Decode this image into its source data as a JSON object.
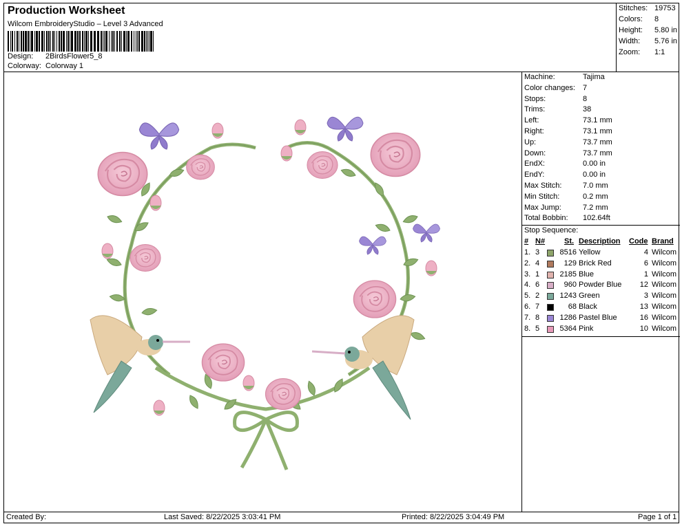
{
  "header": {
    "title": "Production Worksheet",
    "subtitle": "Wilcom EmbroideryStudio – Level 3 Advanced",
    "design_label": "Design:",
    "design_value": "2BirdsFlower5_8",
    "colorway_label": "Colorway:",
    "colorway_value": "Colorway 1"
  },
  "stats": [
    {
      "label": "Stitches:",
      "value": "19753"
    },
    {
      "label": "Colors:",
      "value": "8"
    },
    {
      "label": "Height:",
      "value": "5.80 in"
    },
    {
      "label": "Width:",
      "value": "5.76 in"
    },
    {
      "label": "Zoom:",
      "value": "1:1"
    }
  ],
  "machine_info": [
    {
      "label": "Machine:",
      "value": "Tajima"
    },
    {
      "label": "Color changes:",
      "value": "7"
    },
    {
      "label": "Stops:",
      "value": "8"
    },
    {
      "label": "Trims:",
      "value": "38"
    },
    {
      "label": "Left:",
      "value": "73.1 mm"
    },
    {
      "label": "Right:",
      "value": "73.1 mm"
    },
    {
      "label": "Up:",
      "value": "73.7 mm"
    },
    {
      "label": "Down:",
      "value": "73.7 mm"
    },
    {
      "label": "EndX:",
      "value": "0.00 in"
    },
    {
      "label": "EndY:",
      "value": "0.00 in"
    },
    {
      "label": "Max Stitch:",
      "value": "7.0 mm"
    },
    {
      "label": "Min Stitch:",
      "value": "0.2 mm"
    },
    {
      "label": "Max Jump:",
      "value": "7.2 mm"
    },
    {
      "label": "Total Bobbin:",
      "value": "102.64ft"
    }
  ],
  "stop_sequence": {
    "label": "Stop Sequence:",
    "columns": {
      "idx": "#",
      "n": "N#",
      "st": "St.",
      "desc": "Description",
      "code": "Code",
      "brand": "Brand"
    },
    "rows": [
      {
        "idx": "1.",
        "n": "3",
        "color": "#8fa56b",
        "st": "8516",
        "desc": "Yellow",
        "code": "4",
        "brand": "Wilcom"
      },
      {
        "idx": "2.",
        "n": "4",
        "color": "#b07a5e",
        "st": "129",
        "desc": "Brick Red",
        "code": "6",
        "brand": "Wilcom"
      },
      {
        "idx": "3.",
        "n": "1",
        "color": "#e0b3ae",
        "st": "2185",
        "desc": "Blue",
        "code": "1",
        "brand": "Wilcom"
      },
      {
        "idx": "4.",
        "n": "6",
        "color": "#d7aec6",
        "st": "960",
        "desc": "Powder Blue",
        "code": "12",
        "brand": "Wilcom"
      },
      {
        "idx": "5.",
        "n": "2",
        "color": "#7ba89a",
        "st": "1243",
        "desc": "Green",
        "code": "3",
        "brand": "Wilcom"
      },
      {
        "idx": "6.",
        "n": "7",
        "color": "#000000",
        "st": "68",
        "desc": "Black",
        "code": "13",
        "brand": "Wilcom"
      },
      {
        "idx": "7.",
        "n": "8",
        "color": "#9a86d4",
        "st": "1286",
        "desc": "Pastel Blue",
        "code": "16",
        "brand": "Wilcom"
      },
      {
        "idx": "8.",
        "n": "5",
        "color": "#e69ab8",
        "st": "5364",
        "desc": "Pink",
        "code": "10",
        "brand": "Wilcom"
      }
    ]
  },
  "footer": {
    "created_by": "Created By:",
    "last_saved": "Last Saved: 8/22/2025 3:03:41 PM",
    "printed": "Printed: 8/22/2025 3:04:49 PM",
    "page": "Page 1 of 1"
  },
  "colors": {
    "leaf": "#8fb06f",
    "leaf_dark": "#6f9455",
    "rose": "#eeb0c4",
    "rose_dark": "#d58aa3",
    "butterfly": "#9a86d4",
    "bird_body": "#e8cfa8",
    "bird_head": "#7ba89a"
  }
}
